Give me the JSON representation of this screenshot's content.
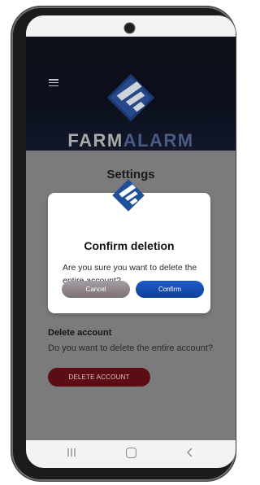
{
  "app": {
    "brand_part1": "FARM",
    "brand_part2": "ALARM",
    "page_title": "Settings"
  },
  "header": {
    "menu_icon": "hamburger-menu-icon",
    "logo_icon": "farmalarm-logo-icon"
  },
  "delete_account": {
    "title": "Delete account",
    "question": "Do you want to delete the entire account?",
    "button_label": "DELETE ACCOUNT"
  },
  "dialog": {
    "title": "Confirm deletion",
    "message": "Are you sure you want to delete the entire account?",
    "cancel_label": "Cancel",
    "confirm_label": "Confirm"
  },
  "navigation": {
    "recent_icon": "recent-apps-icon",
    "home_icon": "home-icon",
    "back_icon": "back-icon"
  },
  "colors": {
    "header_bg": "#0b0f1c",
    "brand_blue": "#4a5b86",
    "confirm_blue": "#1f5ac6",
    "delete_red": "#5c0d14"
  }
}
